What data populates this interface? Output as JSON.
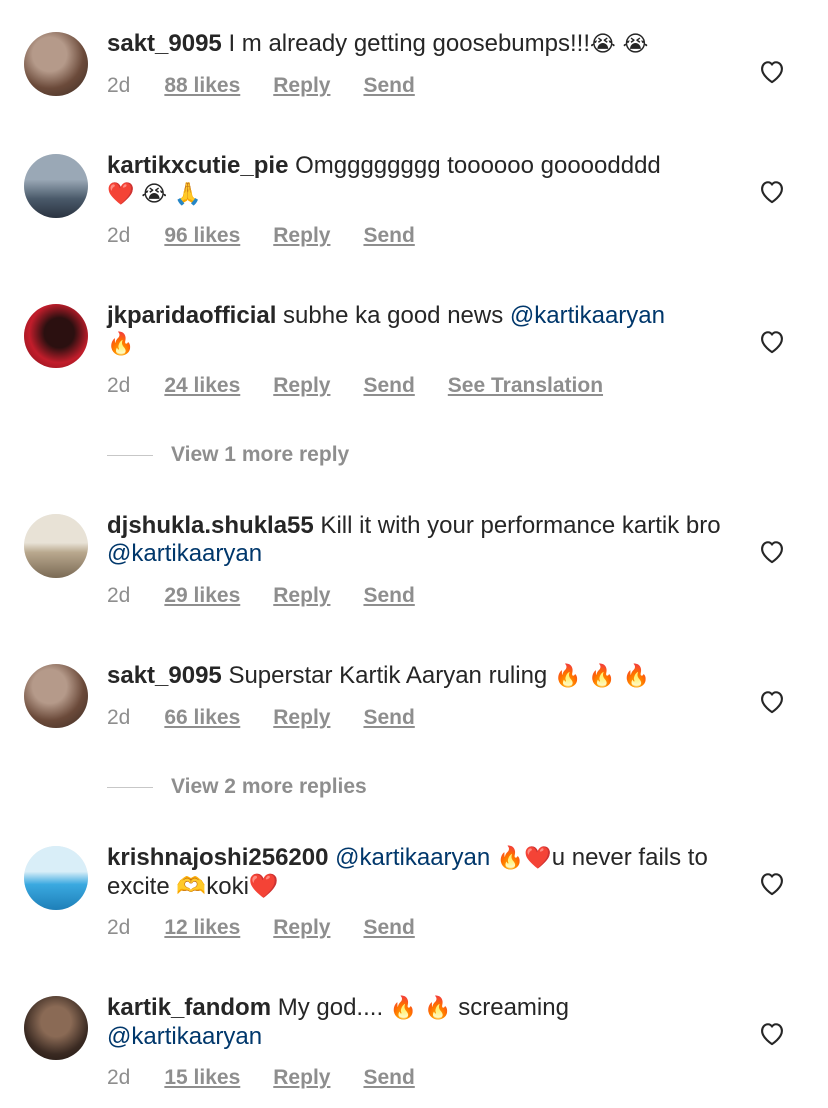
{
  "comments": [
    {
      "username": "sakt_9095",
      "text_before": " I m already getting goosebumps!!!",
      "emojis": "😭 😭",
      "mention": "",
      "text_after": "",
      "time": "2d",
      "likes": "88 likes",
      "reply": "Reply",
      "send": "Send",
      "translate": "",
      "avatar_colors": [
        "#6b4a3a",
        "#b59a8a"
      ]
    },
    {
      "username": "kartikxcutie_pie",
      "text_before": " Omgggggggg toooooo goooodddd",
      "emojis": "❤️ 😭 🙏",
      "mention": "",
      "text_after": "",
      "time": "2d",
      "likes": "96 likes",
      "reply": "Reply",
      "send": "Send",
      "translate": "",
      "avatar_colors": [
        "#4a5a6a",
        "#9aa8b6"
      ]
    },
    {
      "username": "jkparidaofficial",
      "text_before": " subhe ka good news ",
      "emojis": "🔥",
      "mention": "@kartikaaryan",
      "text_after": "",
      "time": "2d",
      "likes": "24 likes",
      "reply": "Reply",
      "send": "Send",
      "translate": "See Translation",
      "avatar_colors": [
        "#c21d2b",
        "#2b1010"
      ]
    },
    {
      "username": "djshukla.shukla55",
      "text_before": " Kill it with your performance kartik bro ",
      "emojis": "",
      "mention": "@kartikaaryan",
      "text_after": "",
      "time": "2d",
      "likes": "29 likes",
      "reply": "Reply",
      "send": "Send",
      "translate": "",
      "avatar_colors": [
        "#d8cfc0",
        "#7a6a55"
      ]
    },
    {
      "username": "sakt_9095",
      "text_before": " Superstar Kartik Aaryan ruling ",
      "emojis": "🔥 🔥 🔥",
      "mention": "",
      "text_after": "",
      "time": "2d",
      "likes": "66 likes",
      "reply": "Reply",
      "send": "Send",
      "translate": "",
      "avatar_colors": [
        "#6b4a3a",
        "#b59a8a"
      ]
    },
    {
      "username": "krishnajoshi256200",
      "text_before": " ",
      "emojis": "🔥❤️",
      "mention": "@kartikaaryan",
      "text_after": "u never fails to excite 🫶koki❤️",
      "time": "2d",
      "likes": "12 likes",
      "reply": "Reply",
      "send": "Send",
      "translate": "",
      "avatar_colors": [
        "#3aa9e0",
        "#d9eef8"
      ]
    },
    {
      "username": "kartik_fandom",
      "text_before": " My god.... ",
      "emojis": "🔥 🔥",
      "mention": "@kartikaaryan",
      "text_after": " screaming",
      "time": "2d",
      "likes": "15 likes",
      "reply": "Reply",
      "send": "Send",
      "translate": "",
      "avatar_colors": [
        "#3a2a22",
        "#8a6a55"
      ]
    }
  ],
  "more_replies": [
    {
      "label": "View 1 more reply"
    },
    {
      "label": "View 2 more replies"
    }
  ],
  "colors": {
    "username": "#262626",
    "text": "#262626",
    "meta": "#8e8e8e",
    "mention": "#00376b",
    "divider": "#c7c7c7"
  }
}
